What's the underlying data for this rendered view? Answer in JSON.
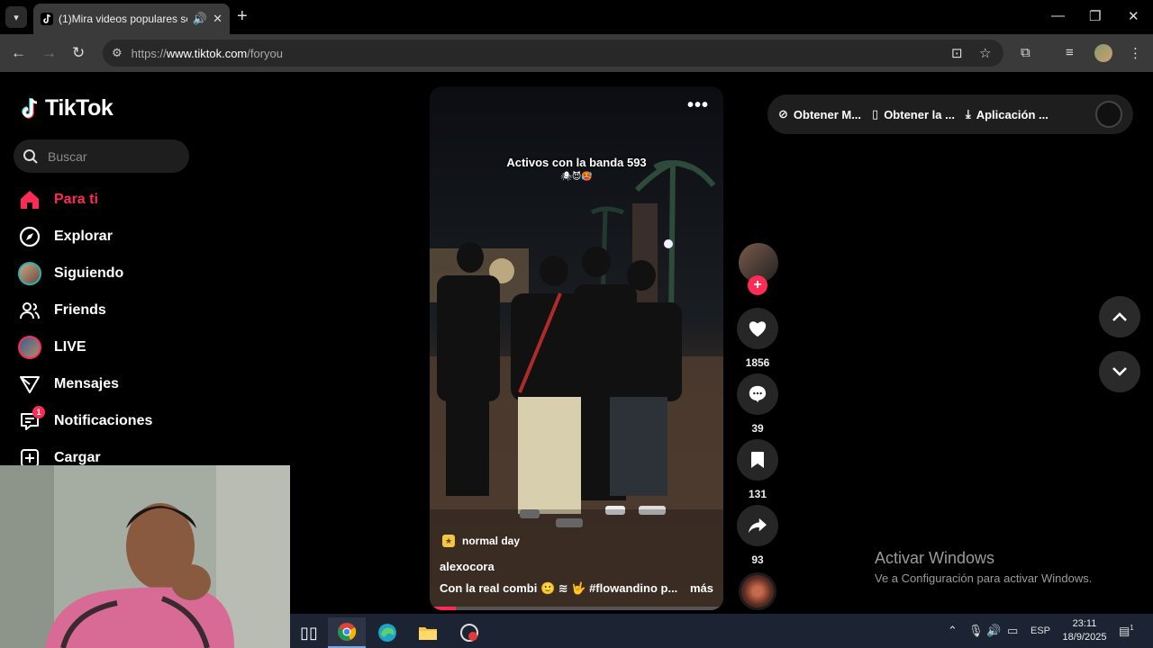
{
  "browser": {
    "tab_title": "(1)Mira videos populares se",
    "url_prefix": "https://",
    "url_host": "www.tiktok.com",
    "url_path": "/foryou"
  },
  "sidebar": {
    "logo_text": "TikTok",
    "search_placeholder": "Buscar",
    "items": [
      {
        "label": "Para ti",
        "icon": "home-icon"
      },
      {
        "label": "Explorar",
        "icon": "compass-icon"
      },
      {
        "label": "Siguiendo",
        "icon": "following-avatar"
      },
      {
        "label": "Friends",
        "icon": "friends-icon"
      },
      {
        "label": "LIVE",
        "icon": "live-avatar"
      },
      {
        "label": "Mensajes",
        "icon": "send-icon"
      },
      {
        "label": "Notificaciones",
        "icon": "notification-icon",
        "badge": "1"
      },
      {
        "label": "Cargar",
        "icon": "upload-icon"
      }
    ]
  },
  "video": {
    "overlay_text": "Activos con la banda 593",
    "overlay_emojis": "🕷😈🥵",
    "music": "normal day",
    "author": "alexocora",
    "description": "Con la real combi 🙂 ≋ 🤟 #flowandino p...",
    "more_label": "más",
    "progress": 0.09
  },
  "actions": {
    "likes": "1856",
    "comments": "39",
    "saves": "131",
    "shares": "93"
  },
  "getbar": {
    "item1": "Obtener M...",
    "item2": "Obtener la ...",
    "item3": "Aplicación ..."
  },
  "watermark": {
    "line1": "Activar Windows",
    "line2": "Ve a Configuración para activar Windows."
  },
  "taskbar": {
    "lang": "ESP",
    "time": "23:11",
    "date": "18/9/2025",
    "notif_count": "1"
  },
  "colors": {
    "accent": "#fe2c55",
    "background": "#000000"
  }
}
